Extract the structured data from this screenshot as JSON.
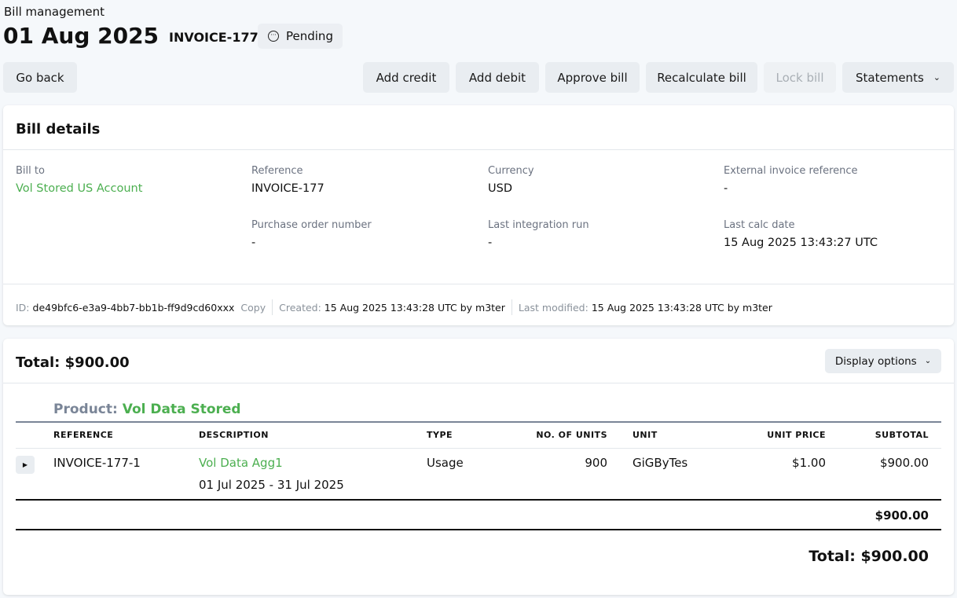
{
  "header": {
    "breadcrumb": "Bill management",
    "date": "01 Aug 2025",
    "invoice": "INVOICE-177",
    "status": "Pending"
  },
  "toolbar": {
    "go_back": "Go back",
    "add_credit": "Add credit",
    "add_debit": "Add debit",
    "approve": "Approve bill",
    "recalculate": "Recalculate bill",
    "lock": "Lock bill",
    "statements": "Statements"
  },
  "details": {
    "title": "Bill details",
    "bill_to_label": "Bill to",
    "bill_to": "Vol Stored US Account",
    "reference_label": "Reference",
    "reference": "INVOICE-177",
    "currency_label": "Currency",
    "currency": "USD",
    "ext_ref_label": "External invoice reference",
    "ext_ref": "-",
    "po_label": "Purchase order number",
    "po": "-",
    "last_int_label": "Last integration run",
    "last_int": "-",
    "last_calc_label": "Last calc date",
    "last_calc": "15 Aug 2025 13:43:27 UTC",
    "id_label": "ID:",
    "id": "de49bfc6-e3a9-4bb7-bb1b-ff9d9cd60xxx",
    "copy": "Copy",
    "created_label": "Created:",
    "created": "15 Aug 2025 13:43:28 UTC by m3ter",
    "modified_label": "Last modified:",
    "modified": "15 Aug 2025 13:43:28 UTC by m3ter"
  },
  "totals": {
    "title": "Total: $900.00",
    "display_options": "Display options",
    "product_label": "Product:",
    "product": "Vol Data Stored",
    "columns": [
      "REFERENCE",
      "DESCRIPTION",
      "TYPE",
      "NO. OF UNITS",
      "UNIT",
      "UNIT PRICE",
      "SUBTOTAL"
    ],
    "row": {
      "reference": "INVOICE-177-1",
      "description": "Vol Data Agg1",
      "period": "01 Jul 2025 - 31 Jul 2025",
      "type": "Usage",
      "units": "900",
      "unit": "GiGByTes",
      "unit_price": "$1.00",
      "subtotal": "$900.00"
    },
    "product_subtotal": "$900.00",
    "grand_total": "Total: $900.00"
  }
}
